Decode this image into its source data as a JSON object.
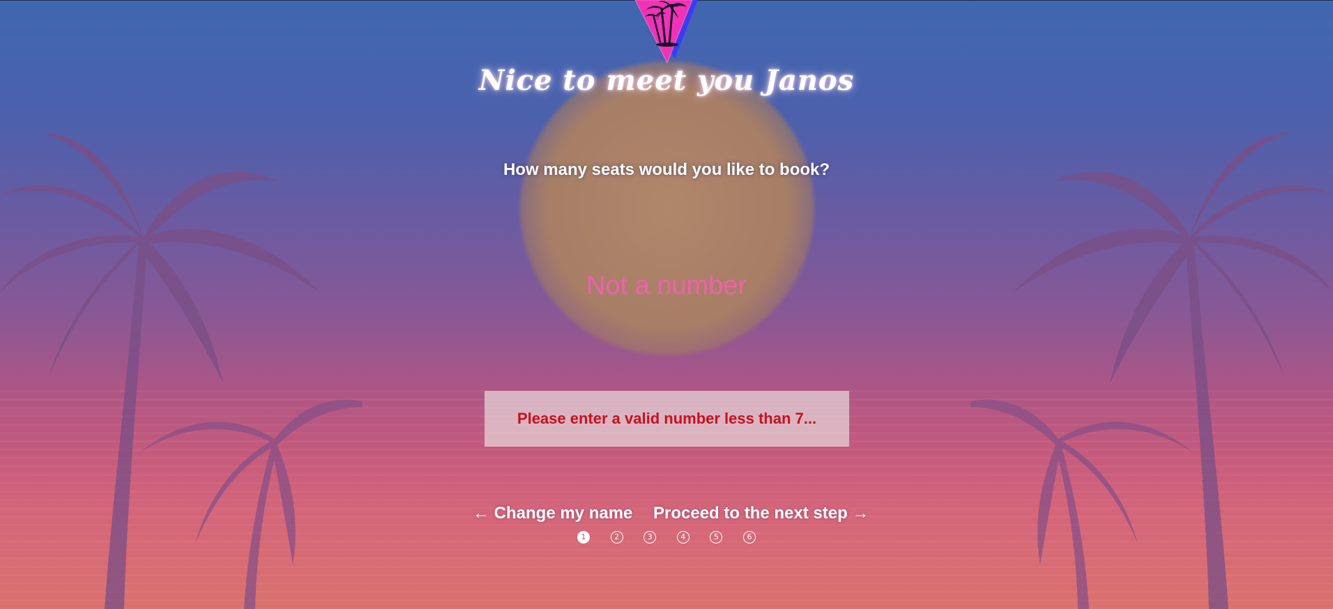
{
  "header": {
    "title": "Nice to meet you Janos",
    "logo_icon": "palm-tree-triangle-logo"
  },
  "form": {
    "question": "How many seats would you like to book?",
    "seat_input": {
      "value": "Not a number",
      "placeholder": ""
    },
    "error_message": "Please enter a valid number less than 7..."
  },
  "navigation": {
    "back_label": "← Change my name",
    "next_label": "Proceed to the next step →"
  },
  "steps": {
    "items": [
      "1",
      "2",
      "3",
      "4",
      "5",
      "6"
    ],
    "current": 1
  },
  "colors": {
    "input_text": "#f060ae",
    "error_text": "#c8101e",
    "logo_pink": "#f033b4",
    "logo_blue": "#3a3df0"
  }
}
